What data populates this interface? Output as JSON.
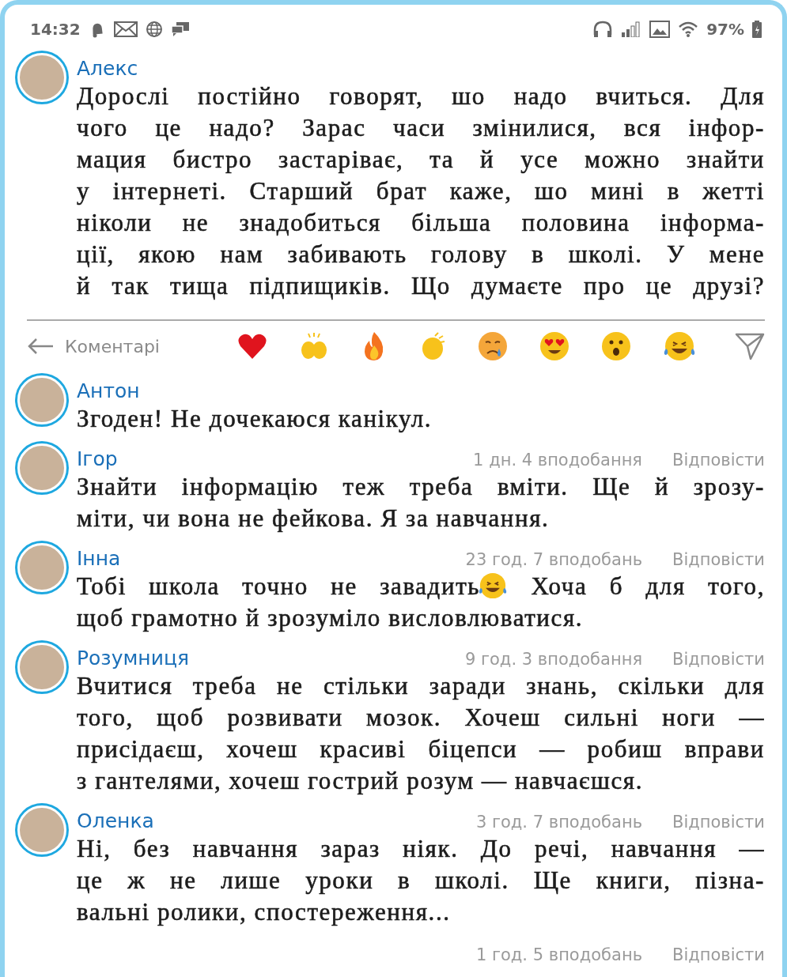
{
  "status_bar": {
    "time": "14:32",
    "battery": "97%"
  },
  "post": {
    "author": "Алекс",
    "lines": [
      "Дорослі постійно говорят, шо надо вчиться. Для",
      "чого це надо? Зарас часи змінилися, вся інфор-",
      "мация бистро застаріває, та й усе можно знайти",
      "у інтернеті. Старший брат каже, шо мині в жетті",
      "ніколи не знадобиться більша половина інформа-",
      "ції, якою нам забивають голову в школі. У мене",
      "й так тища підпищиків. Що думаєте про це друзі?"
    ]
  },
  "comments_bar": {
    "label": "Коментарі"
  },
  "comments": [
    {
      "author": "Антон",
      "lines": [
        "Згоден! Не дочекаюся канікул."
      ],
      "meta": "1 дн. 4 вподобання",
      "reply": "Відповісти"
    },
    {
      "author": "Ігор",
      "lines": [
        "Знайти інформацію теж треба вміти. Ще й зрозу-",
        "міти, чи вона не фейкова. Я за навчання."
      ],
      "meta": "23 год. 7 вподобань",
      "reply": "Відповісти"
    },
    {
      "author": "Інна",
      "lines": [
        {
          "kind": "with-emoji",
          "before": "Тобі школа точно не завадить",
          "after": " Хоча б для того,"
        },
        "щоб грамотно й зрозуміло висловлюватися."
      ],
      "meta": "9 год. 3 вподобання",
      "reply": "Відповісти"
    },
    {
      "author": "Розумниця",
      "lines": [
        "Вчитися треба не стільки заради знань, скільки для",
        "того, щоб розвивати мозок. Хочеш сильні ноги —",
        "присідаєш, хочеш красиві біцепси — робиш вправи",
        "з гантелями, хочеш гострий розум — навчаєшся."
      ],
      "meta": "3 год. 7 вподобань",
      "reply": "Відповісти"
    },
    {
      "author": "Оленка",
      "lines": [
        "Ні, без навчання зараз ніяк. До речі, навчання —",
        "це ж не лише уроки в школі. Ще книги, пізна-",
        "вальні ролики, спостереження..."
      ],
      "meta": "1 год. 5 вподобань",
      "reply": "Відповісти"
    }
  ]
}
